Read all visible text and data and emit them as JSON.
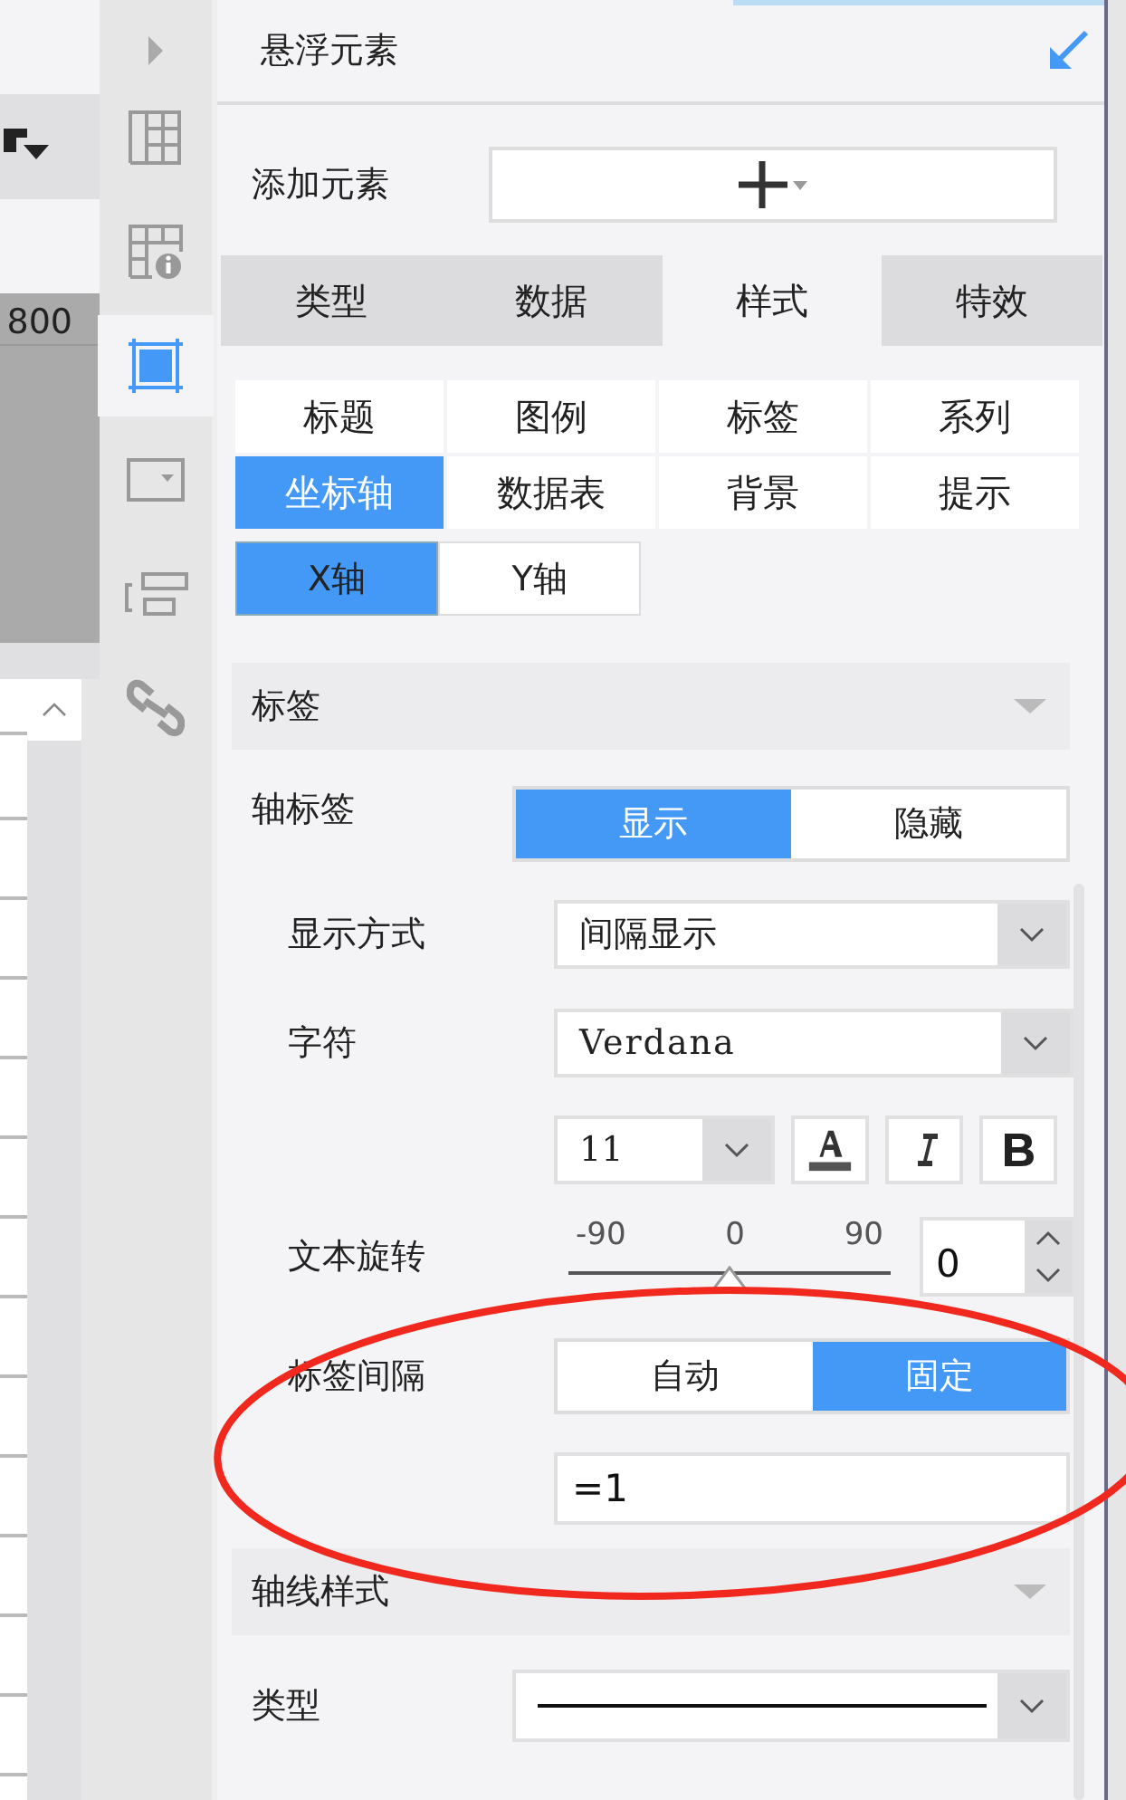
{
  "editor": {
    "ruler_label": "800"
  },
  "rail": {
    "items": [
      {
        "kind": "expand",
        "selected": false
      },
      {
        "kind": "grid",
        "selected": false
      },
      {
        "kind": "table-info",
        "selected": false
      },
      {
        "kind": "frame",
        "selected": true
      },
      {
        "kind": "dropdown",
        "selected": false
      },
      {
        "kind": "stack",
        "selected": false
      },
      {
        "kind": "link",
        "selected": false
      }
    ]
  },
  "panel": {
    "title": "悬浮元素",
    "add_label": "添加元素",
    "main_tabs": [
      {
        "label": "类型",
        "selected": false
      },
      {
        "label": "数据",
        "selected": false
      },
      {
        "label": "样式",
        "selected": true
      },
      {
        "label": "特效",
        "selected": false
      }
    ],
    "sub_tabs": [
      {
        "label": "标题",
        "selected": false
      },
      {
        "label": "图例",
        "selected": false
      },
      {
        "label": "标签",
        "selected": false
      },
      {
        "label": "系列",
        "selected": false
      },
      {
        "label": "坐标轴",
        "selected": true
      },
      {
        "label": "数据表",
        "selected": false
      },
      {
        "label": "背景",
        "selected": false
      },
      {
        "label": "提示",
        "selected": false
      }
    ],
    "axis_tabs": [
      {
        "label": "X轴",
        "selected": true
      },
      {
        "label": "Y轴",
        "selected": false
      }
    ],
    "label_section": {
      "title": "标签",
      "axis_label": {
        "label": "轴标签",
        "options": [
          {
            "label": "显示",
            "selected": true
          },
          {
            "label": "隐藏",
            "selected": false
          }
        ]
      },
      "display_mode": {
        "label": "显示方式",
        "value": "间隔显示"
      },
      "font": {
        "label": "字符",
        "value": "Verdana",
        "size": "11"
      },
      "rotation": {
        "label": "文本旋转",
        "ticks": [
          "-90",
          "0",
          "90"
        ],
        "level": 0.5,
        "value": "0"
      },
      "interval": {
        "label": "标签间隔",
        "options": [
          {
            "label": "自动",
            "selected": false
          },
          {
            "label": "固定",
            "selected": true
          }
        ],
        "value": "=1"
      }
    },
    "axis_line_section": {
      "title": "轴线样式",
      "type_label": "类型"
    }
  }
}
